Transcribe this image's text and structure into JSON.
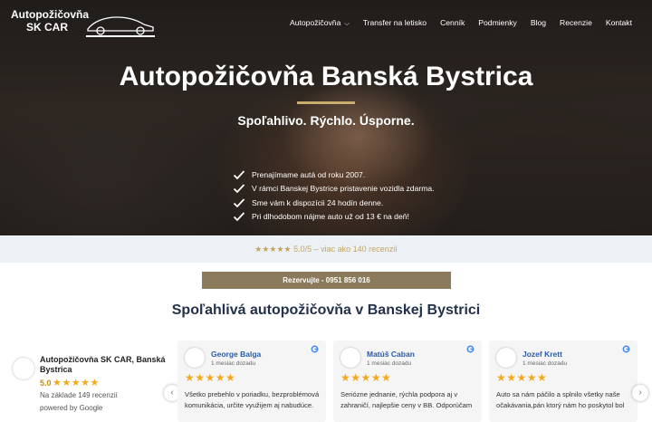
{
  "brand": {
    "logo_text": "Autopožičovňa SK CAR"
  },
  "nav": {
    "items": [
      {
        "label": "Autopožičovňa",
        "has_dropdown": true
      },
      {
        "label": "Transfer na letisko"
      },
      {
        "label": "Cenník"
      },
      {
        "label": "Podmienky"
      },
      {
        "label": "Blog"
      },
      {
        "label": "Recenzie"
      },
      {
        "label": "Kontakt"
      }
    ]
  },
  "hero": {
    "title": "Autopožičovňa Banská Bystrica",
    "subtitle": "Spoľahlivo. Rýchlo. Úsporne.",
    "features": [
      "Prenajímame autá od roku 2007.",
      "V rámci Banskej Bystrice pristavenie vozidla zdarma.",
      "Sme vám k dispozícii 24 hodín denne.",
      "Pri dlhodobom nájme auto už od 13 € na deň!"
    ]
  },
  "rating_strip": {
    "text": "★★★★★ 5.0/5 – viac ako 140 recenzií"
  },
  "cta": {
    "label": "Rezervujte - 0951 856 016"
  },
  "section": {
    "title": "Spoľahlivá autopožičovňa v Banskej Bystrici"
  },
  "google_summary": {
    "name": "Autopožičovňa SK CAR, Banská Bystrica",
    "score": "5.0",
    "stars": "★★★★★",
    "based_on": "Na základe 149 recenzií",
    "powered_by": "powered by Google"
  },
  "reviews": [
    {
      "name": "George Balga",
      "date": "1 mesiac dozadu",
      "stars": "★★★★★",
      "text": "Všetko prebehlo v poriadku, bezproblémová komunikácia, určite využijem aj nabudúce."
    },
    {
      "name": "Matúš Caban",
      "date": "1 mesiac dozadu",
      "stars": "★★★★★",
      "text": "Seriózne jednanie, rýchla podpora aj v zahraničí, najlepšie ceny v BB. Odporúčam"
    },
    {
      "name": "Jozef Krett",
      "date": "1 mesiac dozadu",
      "stars": "★★★★★",
      "text": "Auto sa nám páčilo a splnilo všetky naše očakávania,pán ktorý nám ho poskytol bol"
    }
  ],
  "colors": {
    "accent_gold": "#c8ad6c",
    "cta_bg": "#8b7a5b",
    "strip_bg": "#ecf1f5",
    "title_navy": "#23324a",
    "star": "#f4a81d",
    "reviewer_blue": "#2a5ba8"
  },
  "icons": {
    "check": "check-icon",
    "google": "google-icon",
    "prev": "chevron-left-icon",
    "next": "chevron-right-icon",
    "car": "car-logo-icon"
  }
}
